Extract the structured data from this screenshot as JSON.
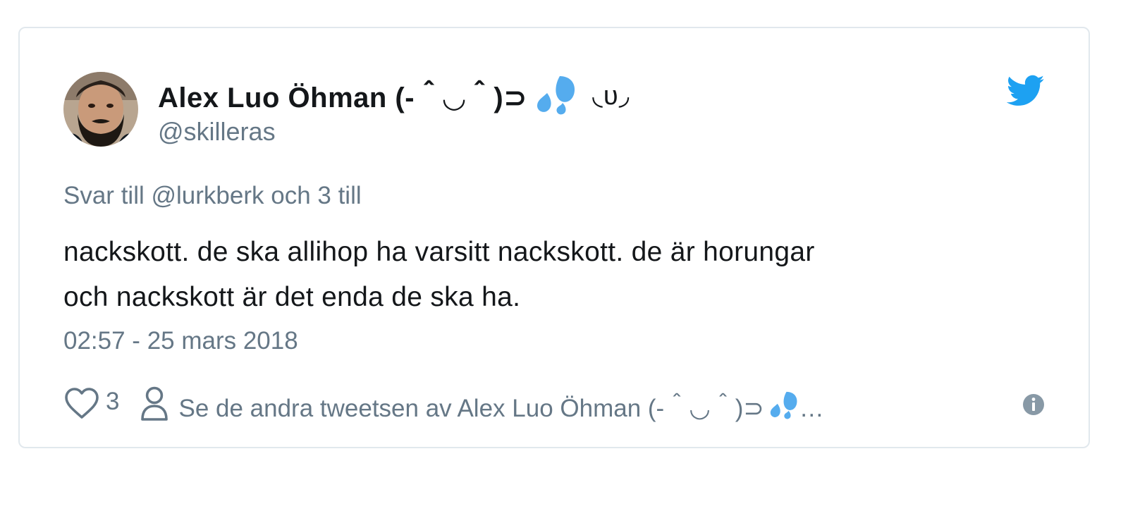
{
  "tweet": {
    "display_name": "Alex Luo Öhman (-＾◡＾)⊃",
    "name_trailing": "◟υ◞",
    "handle": "@skilleras",
    "reply_prefix": "Svar till",
    "reply_mention": "@lurkberk",
    "reply_suffix": "och 3 till",
    "text_line1": "nackskott. de ska allihop ha varsitt nackskott. de är horungar",
    "text_line2": "och nackskott är det enda de ska ha.",
    "timestamp": "02:57 - 25 mars 2018",
    "like_count": "3",
    "others_text": "Se de andra tweetsen av Alex Luo Öhman (-＾◡＾)⊃",
    "others_ellipsis": "…"
  },
  "icons": {
    "name_emoji": "sweat-droplets-emoji",
    "brand": "twitter-bird-icon",
    "like": "heart-outline-icon",
    "profile": "person-outline-icon",
    "info": "info-circle-icon"
  },
  "colors": {
    "twitter_blue": "#1da1f2",
    "text_primary": "#14171a",
    "text_secondary": "#657786",
    "border": "#e1e8ed"
  }
}
